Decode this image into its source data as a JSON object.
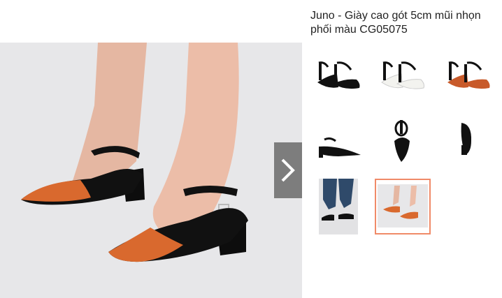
{
  "product": {
    "title_line1": "Juno - Giày cao gót 5cm mũi nhọn",
    "title_line2": "phối màu CG05075"
  },
  "gallery": {
    "active_index": 7,
    "thumbnails": [
      {
        "name": "thumb-pair-black"
      },
      {
        "name": "thumb-pair-white"
      },
      {
        "name": "thumb-pair-brown"
      },
      {
        "name": "thumb-side-view"
      },
      {
        "name": "thumb-front-view"
      },
      {
        "name": "thumb-back-view"
      },
      {
        "name": "thumb-model-jeans"
      },
      {
        "name": "thumb-model-orange"
      }
    ]
  },
  "controls": {
    "next_icon": "chevron-right-icon"
  },
  "colors": {
    "accent_border": "#f08a68",
    "shoe_orange": "#d9692e",
    "shoe_black": "#111111",
    "skin": "#e8b9a4",
    "main_bg": "#e7e7e9",
    "arrow_bg": "#7d7d7d"
  }
}
